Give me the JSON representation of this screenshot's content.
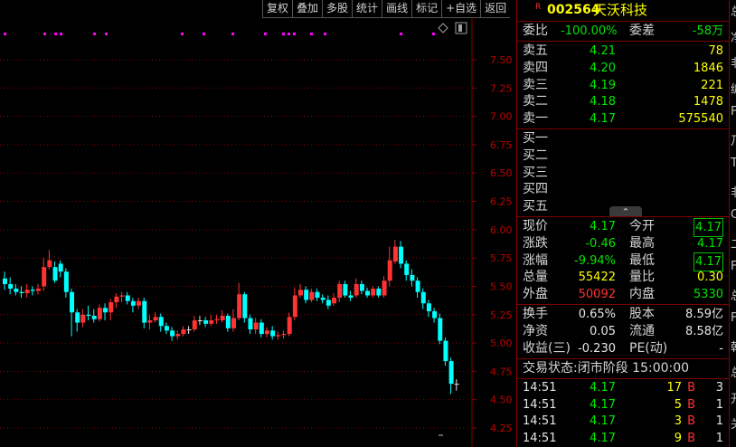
{
  "toolbar": [
    "复权",
    "叠加",
    "多股",
    "统计",
    "画线",
    "标记",
    "+自选",
    "返回"
  ],
  "chart": {
    "price_labels": [
      "7.50",
      "7.25",
      "7.00",
      "6.75",
      "6.50",
      "6.25",
      "6.00",
      "5.75",
      "5.50",
      "5.25",
      "5.00",
      "4.75",
      "4.50",
      "4.25"
    ],
    "y_range": [
      4.25,
      7.5
    ],
    "up_color": "#ff3333",
    "down_color": "#00ffff",
    "candles": [
      [
        5.57,
        5.52,
        5.63,
        5.47
      ],
      [
        5.52,
        5.48,
        5.58,
        5.43
      ],
      [
        5.48,
        5.45,
        5.52,
        5.42
      ],
      [
        5.45,
        5.44,
        5.5,
        5.4
      ],
      [
        5.44,
        5.47,
        5.52,
        5.4
      ],
      [
        5.47,
        5.46,
        5.5,
        5.42
      ],
      [
        5.46,
        5.48,
        5.52,
        5.43
      ],
      [
        5.5,
        5.67,
        5.75,
        5.46
      ],
      [
        5.67,
        5.73,
        5.82,
        5.65
      ],
      [
        5.67,
        5.55,
        5.72,
        5.53
      ],
      [
        5.7,
        5.63,
        5.73,
        5.58
      ],
      [
        5.63,
        5.45,
        5.66,
        5.4
      ],
      [
        5.45,
        5.27,
        5.48,
        5.06
      ],
      [
        5.27,
        5.18,
        5.3,
        5.1
      ],
      [
        5.18,
        5.25,
        5.3,
        5.14
      ],
      [
        5.25,
        5.24,
        5.33,
        5.2
      ],
      [
        5.24,
        5.21,
        5.3,
        5.18
      ],
      [
        5.21,
        5.31,
        5.34,
        5.19
      ],
      [
        5.31,
        5.27,
        5.35,
        5.2
      ],
      [
        5.27,
        5.36,
        5.39,
        5.2
      ],
      [
        5.36,
        5.41,
        5.44,
        5.31
      ],
      [
        5.41,
        5.42,
        5.45,
        5.36
      ],
      [
        5.42,
        5.37,
        5.45,
        5.34
      ],
      [
        5.37,
        5.33,
        5.4,
        5.27
      ],
      [
        5.33,
        5.37,
        5.4,
        5.3
      ],
      [
        5.37,
        5.18,
        5.4,
        5.13
      ],
      [
        5.18,
        5.2,
        5.25,
        5.12
      ],
      [
        5.2,
        5.23,
        5.27,
        5.18
      ],
      [
        5.23,
        5.15,
        5.26,
        5.1
      ],
      [
        5.15,
        5.11,
        5.18,
        5.08
      ],
      [
        5.11,
        5.06,
        5.14,
        5.02
      ],
      [
        5.06,
        5.08,
        5.11,
        5.03
      ],
      [
        5.08,
        5.12,
        5.15,
        5.06
      ],
      [
        5.12,
        5.12,
        5.15,
        5.08
      ],
      [
        5.12,
        5.2,
        5.24,
        5.1
      ],
      [
        5.2,
        5.2,
        5.24,
        5.16
      ],
      [
        5.2,
        5.17,
        5.23,
        5.14
      ],
      [
        5.17,
        5.2,
        5.25,
        5.15
      ],
      [
        5.2,
        5.21,
        5.25,
        5.17
      ],
      [
        5.2,
        5.24,
        5.29,
        5.18
      ],
      [
        5.24,
        5.13,
        5.26,
        5.1
      ],
      [
        5.13,
        5.22,
        5.3,
        5.1
      ],
      [
        5.22,
        5.43,
        5.53,
        5.2
      ],
      [
        5.43,
        5.22,
        5.45,
        5.18
      ],
      [
        5.22,
        5.12,
        5.25,
        5.08
      ],
      [
        5.12,
        5.18,
        5.22,
        5.08
      ],
      [
        5.18,
        5.08,
        5.21,
        5.05
      ],
      [
        5.08,
        5.11,
        5.14,
        5.05
      ],
      [
        5.11,
        5.06,
        5.15,
        5.03
      ],
      [
        5.06,
        5.07,
        5.1,
        5.03
      ],
      [
        5.07,
        5.08,
        5.11,
        5.04
      ],
      [
        5.08,
        5.23,
        5.27,
        5.06
      ],
      [
        5.23,
        5.42,
        5.49,
        5.2
      ],
      [
        5.42,
        5.47,
        5.52,
        5.4
      ],
      [
        5.47,
        5.38,
        5.5,
        5.35
      ],
      [
        5.38,
        5.45,
        5.48,
        5.36
      ],
      [
        5.45,
        5.4,
        5.48,
        5.37
      ],
      [
        5.4,
        5.38,
        5.43,
        5.35
      ],
      [
        5.38,
        5.33,
        5.42,
        5.3
      ],
      [
        5.35,
        5.4,
        5.44,
        5.33
      ],
      [
        5.4,
        5.52,
        5.55,
        5.36
      ],
      [
        5.52,
        5.42,
        5.55,
        5.4
      ],
      [
        5.42,
        5.4,
        5.46,
        5.37
      ],
      [
        5.42,
        5.52,
        5.57,
        5.4
      ],
      [
        5.52,
        5.46,
        5.55,
        5.43
      ],
      [
        5.46,
        5.42,
        5.49,
        5.4
      ],
      [
        5.42,
        5.48,
        5.5,
        5.4
      ],
      [
        5.48,
        5.42,
        5.5,
        5.4
      ],
      [
        5.42,
        5.55,
        5.59,
        5.4
      ],
      [
        5.55,
        5.73,
        5.85,
        5.5
      ],
      [
        5.72,
        5.85,
        5.91,
        5.7
      ],
      [
        5.85,
        5.7,
        5.9,
        5.66
      ],
      [
        5.7,
        5.6,
        5.73,
        5.55
      ],
      [
        5.6,
        5.55,
        5.65,
        5.5
      ],
      [
        5.55,
        5.45,
        5.58,
        5.4
      ],
      [
        5.45,
        5.35,
        5.48,
        5.3
      ],
      [
        5.35,
        5.28,
        5.38,
        5.23
      ],
      [
        5.28,
        5.22,
        5.31,
        5.18
      ],
      [
        5.22,
        5.02,
        5.26,
        4.99
      ],
      [
        5.02,
        4.84,
        5.05,
        4.8
      ],
      [
        4.84,
        4.64,
        4.87,
        4.55
      ],
      [
        4.64,
        4.64,
        4.68,
        4.58
      ]
    ],
    "markers_x": [
      4,
      48,
      60,
      66,
      103,
      116,
      200,
      224,
      256,
      292,
      312,
      318,
      324,
      343,
      358,
      442,
      478
    ]
  },
  "quote": {
    "code": "002564",
    "name": "天沃科技",
    "r_mark": "R",
    "wb_label": "委比",
    "wb_value": "-100.00%",
    "wc_label": "委差",
    "wc_value": "-58万",
    "asks": [
      {
        "label": "卖五",
        "price": "4.21",
        "vol": "78"
      },
      {
        "label": "卖四",
        "price": "4.20",
        "vol": "1846"
      },
      {
        "label": "卖三",
        "price": "4.19",
        "vol": "221"
      },
      {
        "label": "卖二",
        "price": "4.18",
        "vol": "1478"
      },
      {
        "label": "卖一",
        "price": "4.17",
        "vol": "575540"
      }
    ],
    "bids": [
      {
        "label": "买一"
      },
      {
        "label": "买二"
      },
      {
        "label": "买三"
      },
      {
        "label": "买四"
      },
      {
        "label": "买五"
      }
    ],
    "collapse_glyph": "⌃",
    "stats": [
      {
        "l1": "现价",
        "v1": "4.17",
        "l2": "今开",
        "v2": "4.17"
      },
      {
        "l1": "涨跌",
        "v1": "-0.46",
        "l2": "最高",
        "v2": "4.17"
      },
      {
        "l1": "涨幅",
        "v1": "-9.94%",
        "l2": "最低",
        "v2": "4.17"
      },
      {
        "l1": "总量",
        "v1": "55422",
        "l2": "量比",
        "v2": "0.30"
      },
      {
        "l1": "外盘",
        "v1": "50092",
        "l2": "内盘",
        "v2": "5330"
      }
    ],
    "fund": [
      {
        "l1": "换手",
        "v1": "0.65%",
        "l2": "股本",
        "v2": "8.59亿"
      },
      {
        "l1": "净资",
        "v1": "0.05",
        "l2": "流通",
        "v2": "8.58亿"
      },
      {
        "l1": "收益(三)",
        "v1": "-0.230",
        "l2": "PE(动)",
        "v2": "-"
      }
    ],
    "status": "交易状态:闭市阶段 15:00:00",
    "ticks": [
      {
        "time": "14:51",
        "price": "4.17",
        "vol": "17",
        "bs": "B",
        "n": "3"
      },
      {
        "time": "14:51",
        "price": "4.17",
        "vol": "5",
        "bs": "B",
        "n": "1"
      },
      {
        "time": "14:51",
        "price": "4.17",
        "vol": "3",
        "bs": "B",
        "n": "1"
      },
      {
        "time": "14:51",
        "price": "4.17",
        "vol": "9",
        "bs": "B",
        "n": "1"
      }
    ]
  },
  "right_strip": [
    "总",
    "净",
    "非",
    "编",
    "F",
    "乃",
    "T",
    "非",
    "O",
    "二",
    "F",
    "总",
    "F",
    "乾",
    "总",
    "开",
    "关"
  ]
}
